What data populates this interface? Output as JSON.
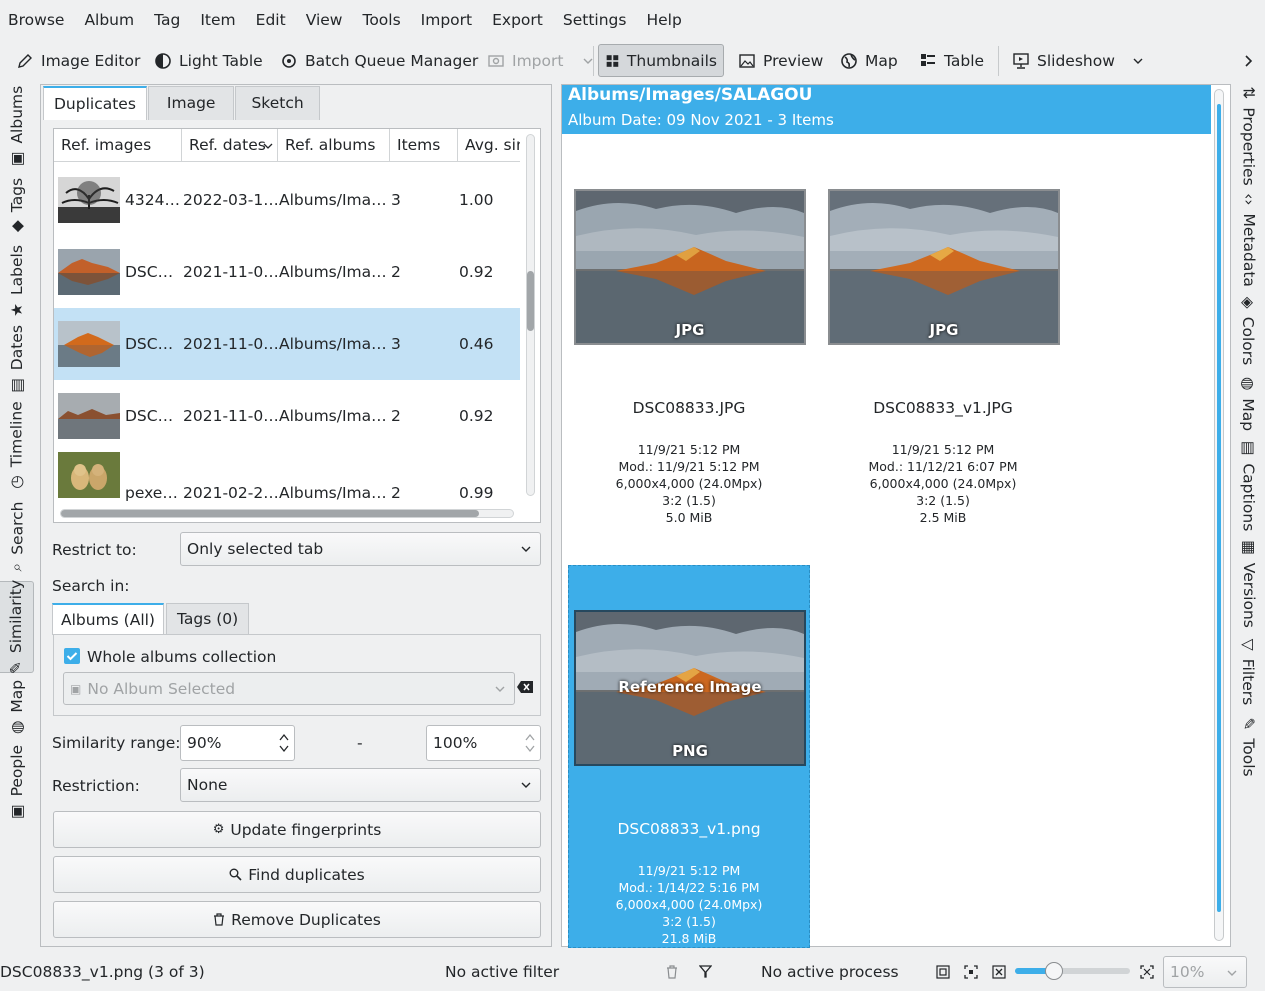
{
  "menu": [
    "Browse",
    "Album",
    "Tag",
    "Item",
    "Edit",
    "View",
    "Tools",
    "Import",
    "Export",
    "Settings",
    "Help"
  ],
  "toolbar": {
    "image_editor": "Image Editor",
    "light_table": "Light Table",
    "bqm": "Batch Queue Manager",
    "import": "Import",
    "thumbnails": "Thumbnails",
    "preview": "Preview",
    "map": "Map",
    "table": "Table",
    "slideshow": "Slideshow"
  },
  "left_sidebar": [
    "Albums",
    "Tags",
    "Labels",
    "Dates",
    "Timeline",
    "Search",
    "Similarity",
    "Map",
    "People"
  ],
  "right_sidebar": [
    "Properties",
    "Metadata",
    "Colors",
    "Map",
    "Captions",
    "Versions",
    "Filters",
    "Tools"
  ],
  "panel": {
    "tabs": [
      "Duplicates",
      "Image",
      "Sketch"
    ],
    "columns": [
      "Ref. images",
      "Ref. dates",
      "Ref. albums",
      "Items",
      "Avg. sim"
    ],
    "rows": [
      {
        "name": "4324…",
        "date": "2022-03-1…",
        "album": "Albums/Ima…",
        "items": "3",
        "sim": "1.00"
      },
      {
        "name": "DSC…",
        "date": "2021-11-0…",
        "album": "Albums/Ima…",
        "items": "2",
        "sim": "0.92"
      },
      {
        "name": "DSC…",
        "date": "2021-11-0…",
        "album": "Albums/Ima…",
        "items": "3",
        "sim": "0.46"
      },
      {
        "name": "DSC…",
        "date": "2021-11-0…",
        "album": "Albums/Ima…",
        "items": "2",
        "sim": "0.92"
      },
      {
        "name": "pexe…",
        "date": "2021-02-2…",
        "album": "Albums/Ima…",
        "items": "2",
        "sim": "0.99"
      }
    ],
    "restrict_label": "Restrict to:",
    "restrict_value": "Only selected tab",
    "search_in": "Search in:",
    "albums_tab": "Albums (All)",
    "tags_tab": "Tags (0)",
    "whole_albums": "Whole albums collection",
    "no_album": "No Album Selected",
    "similarity_label": "Similarity range:",
    "sim_min": "90%",
    "sim_dash": "-",
    "sim_max": "100%",
    "restriction_label": "Restriction:",
    "restriction_value": "None",
    "update_btn": "Update fingerprints",
    "find_btn": "Find duplicates",
    "remove_btn": "Remove Duplicates"
  },
  "main": {
    "title": "Albums/Images/SALAGOU",
    "subtitle": "Album Date: 09 Nov 2021 - 3 Items",
    "items": [
      {
        "badge": "JPG",
        "name": "DSC08833.JPG",
        "date": "11/9/21 5:12 PM",
        "mod": "Mod.: 11/9/21 5:12 PM",
        "dims": "6,000x4,000 (24.0Mpx)",
        "ratio": "3:2 (1.5)",
        "size": "5.0 MiB"
      },
      {
        "badge": "JPG",
        "name": "DSC08833_v1.JPG",
        "date": "11/9/21 5:12 PM",
        "mod": "Mod.: 11/12/21 6:07 PM",
        "dims": "6,000x4,000 (24.0Mpx)",
        "ratio": "3:2 (1.5)",
        "size": "2.5 MiB"
      },
      {
        "badge": "PNG",
        "ref": "Reference Image",
        "name": "DSC08833_v1.png",
        "date": "11/9/21 5:12 PM",
        "mod": "Mod.: 1/14/22 5:16 PM",
        "dims": "6,000x4,000 (24.0Mpx)",
        "ratio": "3:2 (1.5)",
        "size": "21.8 MiB"
      }
    ]
  },
  "status": {
    "item": "DSC08833_v1.png (3 of 3)",
    "filter": "No active filter",
    "process": "No active process",
    "zoom": "10%"
  },
  "colors": {
    "accent": "#3daee9",
    "selection_row": "#c3e1f5"
  }
}
